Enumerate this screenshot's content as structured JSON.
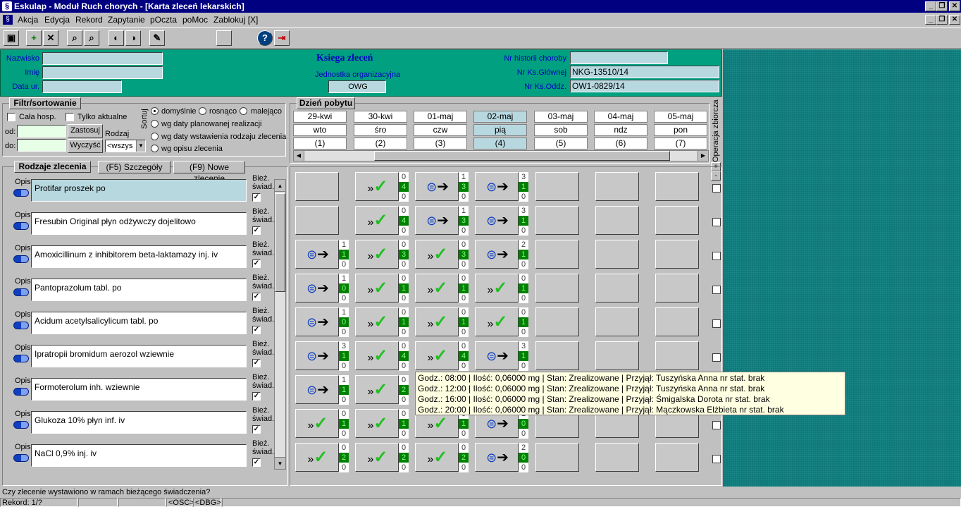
{
  "app": {
    "title": "Eskulap - Moduł Ruch chorych - [Karta zleceń lekarskich]"
  },
  "menu": [
    "Akcja",
    "Edycja",
    "Rekord",
    "Zapytanie",
    "pOczta",
    "poMoc",
    "Zablokuj [X]"
  ],
  "header": {
    "nazwisko_label": "Nazwisko",
    "imie_label": "Imię",
    "data_label": "Data ur.",
    "title": "Ksiega zleceń",
    "unit_label": "Jednostka organizacyjna",
    "unit_value": "OWG",
    "nrhist_label": "Nr historii choroby",
    "nrksgl_label": "Nr Ks.Głównej",
    "nrksgl_value": "NKG-13510/14",
    "nrksodz_label": "Nr Ks.Oddz.",
    "nrksodz_value": "OW1-0829/14"
  },
  "filter": {
    "tab": "Filtr/sortowanie",
    "cala": "Cała hosp.",
    "tylko": "Tylko aktualne",
    "od": "od:",
    "do": "do:",
    "zastosuj": "Zastosuj",
    "wyczysc": "Wyczyść",
    "rodzaj": "Rodzaj",
    "rodzaj_value": "<wszys",
    "sortuj": "Sortuj",
    "domyslnie": "domyślnie",
    "rosnaco": "rosnąco",
    "malejaco": "malejąco",
    "opt1": "wg daty planowanej realizacji",
    "opt2": "wg daty wstawienia rodzaju zlecenia",
    "opt3": "wg opisu zlecenia"
  },
  "days": {
    "tab": "Dzień pobytu",
    "items": [
      {
        "date": "29-kwi",
        "dow": "wto",
        "n": "(1)"
      },
      {
        "date": "30-kwi",
        "dow": "śro",
        "n": "(2)"
      },
      {
        "date": "01-maj",
        "dow": "czw",
        "n": "(3)"
      },
      {
        "date": "02-maj",
        "dow": "pią",
        "n": "(4)"
      },
      {
        "date": "03-maj",
        "dow": "sob",
        "n": "(5)"
      },
      {
        "date": "04-maj",
        "dow": "ndz",
        "n": "(6)"
      },
      {
        "date": "05-maj",
        "dow": "pon",
        "n": "(7)"
      }
    ],
    "operacja": "Operacja zbiorcza"
  },
  "orders": {
    "tab": "Rodzaje zlecenia",
    "szczegoly": "(F5) Szczegóły",
    "nowe": "(F9) Nowe zlecenie",
    "opis": "Opis",
    "biez1": "Bież.",
    "biez2": "świad.",
    "items": [
      "Protifar proszek po",
      "Fresubin Original płyn odżywczy dojelitowo",
      "Amoxicillinum z inhibitorem beta-laktamazy inj. iv",
      "Pantoprazolum tabl. po",
      "Acidum acetylsalicylicum tabl. po",
      "Ipratropii bromidum aerozol wziewnie",
      "Formoterolum inh. wziewnie",
      "Glukoza 10% płyn inf. iv",
      "NaCl 0,9% inj. iv"
    ]
  },
  "grid": [
    [
      null,
      {
        "i": "check",
        "c": [
          "0",
          "4",
          "0"
        ]
      },
      {
        "i": "pill",
        "c": [
          "1",
          "3",
          "0"
        ]
      },
      {
        "i": "pill",
        "c": [
          "3",
          "1",
          "0"
        ]
      },
      null,
      null,
      null
    ],
    [
      null,
      {
        "i": "check",
        "c": [
          "0",
          "4",
          "0"
        ]
      },
      {
        "i": "pill",
        "c": [
          "1",
          "3",
          "0"
        ]
      },
      {
        "i": "pill",
        "c": [
          "3",
          "1",
          "0"
        ]
      },
      null,
      null,
      null
    ],
    [
      {
        "i": "pill",
        "c": [
          "1",
          "1",
          "0"
        ]
      },
      {
        "i": "check",
        "c": [
          "0",
          "3",
          "0"
        ]
      },
      {
        "i": "check",
        "c": [
          "0",
          "3",
          "0"
        ]
      },
      {
        "i": "pill",
        "c": [
          "2",
          "1",
          "0"
        ]
      },
      null,
      null,
      null
    ],
    [
      {
        "i": "pill",
        "c": [
          "1",
          "0",
          "0"
        ]
      },
      {
        "i": "check",
        "c": [
          "0",
          "1",
          "0"
        ]
      },
      {
        "i": "check",
        "c": [
          "0",
          "1",
          "0"
        ]
      },
      {
        "i": "check",
        "c": [
          "0",
          "1",
          "0"
        ]
      },
      null,
      null,
      null
    ],
    [
      {
        "i": "pill",
        "c": [
          "1",
          "0",
          "0"
        ]
      },
      {
        "i": "check",
        "c": [
          "0",
          "1",
          "0"
        ]
      },
      {
        "i": "check",
        "c": [
          "0",
          "1",
          "0"
        ]
      },
      {
        "i": "check",
        "c": [
          "0",
          "1",
          "0"
        ]
      },
      null,
      null,
      null
    ],
    [
      {
        "i": "pill",
        "c": [
          "3",
          "1",
          "0"
        ]
      },
      {
        "i": "check",
        "c": [
          "0",
          "4",
          "0"
        ]
      },
      {
        "i": "check",
        "c": [
          "0",
          "4",
          "0"
        ]
      },
      {
        "i": "pill",
        "c": [
          "3",
          "1",
          "0"
        ]
      },
      null,
      null,
      null
    ],
    [
      {
        "i": "pill",
        "c": [
          "1",
          "1",
          "0"
        ]
      },
      {
        "i": "check",
        "c": [
          "0",
          "2",
          "0"
        ]
      },
      null,
      null,
      null,
      null,
      null
    ],
    [
      {
        "i": "check",
        "c": [
          "0",
          "1",
          "0"
        ]
      },
      {
        "i": "check",
        "c": [
          "0",
          "1",
          "0"
        ]
      },
      {
        "i": "check",
        "c": [
          "0",
          "1",
          "0"
        ]
      },
      {
        "i": "pill",
        "c": [
          "1",
          "0",
          "0"
        ]
      },
      null,
      null,
      null
    ],
    [
      {
        "i": "check",
        "c": [
          "0",
          "2",
          "0"
        ]
      },
      {
        "i": "check",
        "c": [
          "0",
          "2",
          "0"
        ]
      },
      {
        "i": "check",
        "c": [
          "0",
          "2",
          "0"
        ]
      },
      {
        "i": "pill",
        "c": [
          "2",
          "0",
          "0"
        ]
      },
      null,
      null,
      null
    ]
  ],
  "tooltip": [
    "Godz.: 08:00 | Ilość: 0,06000 mg | Stan: Zrealizowane | Przyjął: Tuszyńska Anna nr stat. brak",
    "Godz.: 12:00 | Ilość: 0,06000 mg | Stan: Zrealizowane | Przyjął: Tuszyńska Anna nr stat. brak",
    "Godz.: 16:00 | Ilość: 0,06000 mg | Stan: Zrealizowane | Przyjął: Śmigalska Dorota nr stat. brak",
    "Godz.: 20:00 | Ilość: 0,06000 mg | Stan: Zrealizowane | Przyjął: Mączkowska Elżbieta nr stat. brak"
  ],
  "status": {
    "question": "Czy zlecenie wystawiono w ramach bieżącego świadczenia?",
    "rekord": "Rekord: 1/?",
    "osc": "<OSC>",
    "dbg": "<DBG>"
  }
}
